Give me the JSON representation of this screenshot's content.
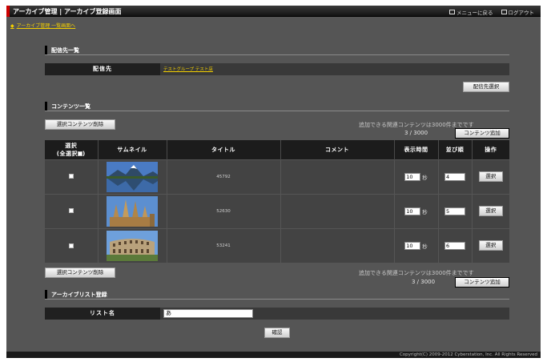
{
  "header": {
    "title": "アーカイブ管理 | アーカイブ登録画面",
    "menu_link": "メニューに戻る",
    "logout_link": "ログアウト"
  },
  "breadcrumb": "アーカイブ管理 一覧画面へ",
  "delivery": {
    "section_title": "配信先一覧",
    "label": "配信先",
    "value": "テストグループ テスト店",
    "select_button": "配信先選択"
  },
  "contents": {
    "section_title": "コンテンツ一覧",
    "delete_button": "選択コンテンツ削除",
    "note": "追加できる関連コンテンツは3000件までです",
    "count": "3 / 3000",
    "add_button": "コンテンツ追加",
    "columns": {
      "select": "選択",
      "select_all": "(全選択",
      "thumbnail": "サムネイル",
      "title": "タイトル",
      "comment": "コメント",
      "display_time": "表示時間",
      "order": "並び順",
      "action": "操作"
    },
    "rows": [
      {
        "title": "45792",
        "comment": "",
        "time": "10",
        "unit": "秒",
        "order": "4",
        "action": "選択",
        "thumb": "mountain-lake-thumbnail"
      },
      {
        "title": "52630",
        "comment": "",
        "time": "10",
        "unit": "秒",
        "order": "5",
        "action": "選択",
        "thumb": "cathedral-thumbnail"
      },
      {
        "title": "53241",
        "comment": "",
        "time": "10",
        "unit": "秒",
        "order": "6",
        "action": "選択",
        "thumb": "colosseum-thumbnail"
      }
    ]
  },
  "list": {
    "section_title": "アーカイブリスト登録",
    "label": "リスト名",
    "value": "あ",
    "confirm_button": "確認"
  },
  "footer": "Copyright(C) 2009-2012 Cyberstation, Inc. All Rights Reserved"
}
